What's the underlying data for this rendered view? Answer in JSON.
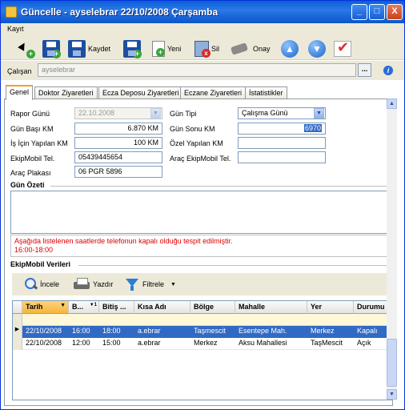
{
  "window": {
    "title": "Güncelle - ayselebrar 22/10/2008 Çarşamba",
    "btn_min": "_",
    "btn_max": "□",
    "btn_close": "X"
  },
  "menu": {
    "kayit": "Kayıt"
  },
  "toolbar": {
    "save_label": "Kaydet",
    "new_label": "Yeni",
    "delete_label": "Sil",
    "approve_label": "Onay"
  },
  "calisan": {
    "label": "Çalışan",
    "value": "ayselebrar",
    "dots": "...",
    "info": "i"
  },
  "tabs": [
    "Genel",
    "Doktor Ziyaretleri",
    "Ecza Deposu Ziyaretleri",
    "Eczane Ziyaretleri",
    "İstatistikler"
  ],
  "form": {
    "rapor_gunu": {
      "label": "Rapor Günü",
      "value": "22.10.2008"
    },
    "gun_basi_km": {
      "label": "Gün Başı KM",
      "value": "6.870 KM"
    },
    "is_icin_km": {
      "label": "İş İçin Yapılan KM",
      "value": "100 KM"
    },
    "ekipmobil_tel": {
      "label": "EkipMobil Tel.",
      "value": "05439445654"
    },
    "arac_plakasi": {
      "label": "Araç Plakası",
      "value": "06 PGR 5896"
    },
    "gun_tipi": {
      "label": "Gün Tipi",
      "value": "Çalışma Günü"
    },
    "gun_sonu_km": {
      "label": "Gün Sonu KM",
      "value": "6970"
    },
    "ozel_km": {
      "label": "Özel Yapılan KM",
      "value": ""
    },
    "arac_ekipmobil_tel": {
      "label": "Araç EkipMobil Tel.",
      "value": ""
    }
  },
  "gun_ozeti": {
    "title": "Gün Özeti"
  },
  "warning": {
    "line1": "Aşağıda listelenen saatlerde telefonun kapalı olduğu tespit edilmiştir.",
    "line2": "16:00-18:00"
  },
  "ekipmobil": {
    "title": "EkipMobil Verileri",
    "incele": "İncele",
    "yazdir": "Yazdır",
    "filtrele": "Filtrele"
  },
  "grid": {
    "columns": [
      "Tarih",
      "B...",
      "Bitiş ...",
      "Kısa Adı",
      "Bölge",
      "Mahalle",
      "Yer",
      "Durumu"
    ],
    "sort_marker": "▼",
    "sort_marker_2": "▼1",
    "rows": [
      [
        "22/10/2008",
        "16:00",
        "18:00",
        "a.ebrar",
        "Taşmescit",
        "Esentepe Mah.",
        "Merkez",
        "Kapalı"
      ],
      [
        "22/10/2008",
        "12:00",
        "15:00",
        "a.ebrar",
        "Merkez",
        "Aksu Mahallesi",
        "TaşMescit",
        "Açık"
      ]
    ]
  },
  "colors": {
    "accent": "#316ac5",
    "warning": "#e00000",
    "titlebar": "#0a5fd8",
    "sort_header": "#f5b63c"
  }
}
